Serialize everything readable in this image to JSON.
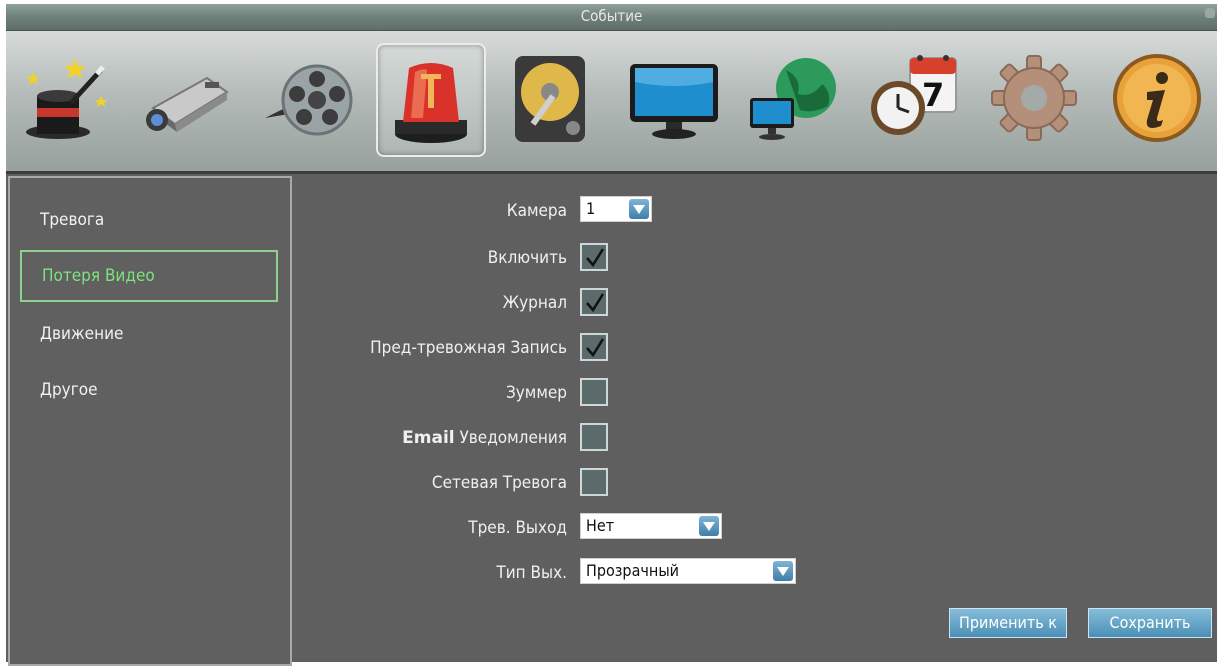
{
  "window": {
    "title": "Событие"
  },
  "toolbar": {
    "icons": [
      "magic-hat-icon",
      "camera-icon",
      "film-reel-icon",
      "alarm-siren-icon",
      "hard-disk-icon",
      "monitor-icon",
      "network-globe-icon",
      "schedule-calendar-icon",
      "settings-gear-icon",
      "info-icon"
    ],
    "active_index": 3,
    "calendar_day": "7"
  },
  "sidebar": {
    "items": [
      {
        "label": "Тревога"
      },
      {
        "label": "Потеря Видео"
      },
      {
        "label": "Движение"
      },
      {
        "label": "Другое"
      }
    ],
    "selected_index": 1
  },
  "form": {
    "camera": {
      "label": "Камера",
      "value": "1"
    },
    "enable": {
      "label": "Включить",
      "checked": true
    },
    "log": {
      "label": "Журнал",
      "checked": true
    },
    "prealarm": {
      "label": "Пред-тревожная Запись",
      "checked": true
    },
    "buzzer": {
      "label": "Зуммер",
      "checked": false
    },
    "email": {
      "label_bold": "Email",
      "label": "Уведомления",
      "checked": false
    },
    "net_alarm": {
      "label": "Сетевая Тревога",
      "checked": false
    },
    "alarm_out": {
      "label": "Трев. Выход",
      "value": "Нет"
    },
    "out_type": {
      "label": "Тип Вых.",
      "value": "Прозрачный"
    }
  },
  "buttons": {
    "apply": "Применить к",
    "save": "Сохранить"
  },
  "colors": {
    "accent_blue": "#4b8fb6",
    "selected_green": "#7ee27e",
    "background": "#5f5f5f"
  }
}
